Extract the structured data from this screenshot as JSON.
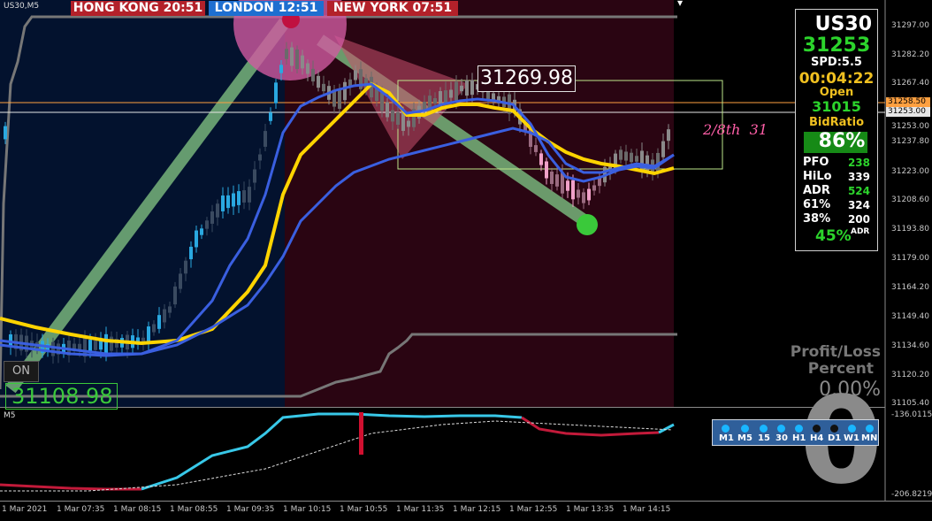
{
  "chart": {
    "symbol_label": "US30,M5",
    "subwindow_label": "M5",
    "on_button": "ON",
    "low_marker": "31108.98",
    "high_marker": "31269.98",
    "fib_text": "2/8th  31",
    "pl_title_1": "Profit/Loss",
    "pl_title_2": "Percent",
    "pl_value": "0.00%",
    "big_counter": "0"
  },
  "sessions": [
    {
      "label": "HONG KONG  20:51",
      "color": "#b3212a"
    },
    {
      "label": "LONDON  12:51",
      "color": "#1e6fd0"
    },
    {
      "label": "NEW YORK  07:51",
      "color": "#b3212a"
    }
  ],
  "panel": {
    "symbol": "US30",
    "price": "31253",
    "spread": "SPD:5.5",
    "countdown": "00:04:22",
    "open_label": "Open",
    "open_value": "31015",
    "bidratio_label": "BidRatio",
    "bidratio_value": "86%",
    "pct_value": "45%",
    "pct_suffix": "ADR",
    "stats": [
      {
        "k": "PFO",
        "v": "238",
        "c": "#2cd42c"
      },
      {
        "k": "HiLo",
        "v": "339",
        "c": "#ffffff"
      },
      {
        "k": "ADR",
        "v": "524",
        "c": "#2cd42c"
      },
      {
        "k": "61%",
        "v": "324",
        "c": "#ffffff"
      },
      {
        "k": "38%",
        "v": "200",
        "c": "#ffffff"
      }
    ]
  },
  "price_axis": [
    "31297.00",
    "31282.20",
    "31267.40",
    "31253.00",
    "31237.80",
    "31223.00",
    "31208.60",
    "31193.80",
    "31179.00",
    "31164.20",
    "31149.40",
    "31134.60",
    "31120.20",
    "31105.40"
  ],
  "price_tags": [
    {
      "label": "31258.50",
      "color": "#ffa040"
    },
    {
      "label": "31253.00",
      "color": "#e6e6e6"
    }
  ],
  "sub_axis": [
    "-136.0115",
    "-206.8219"
  ],
  "time_axis": [
    "1 Mar 2021",
    "1 Mar 07:35",
    "1 Mar 08:15",
    "1 Mar 08:55",
    "1 Mar 09:35",
    "1 Mar 10:15",
    "1 Mar 10:55",
    "1 Mar 11:35",
    "1 Mar 12:15",
    "1 Mar 12:55",
    "1 Mar 13:35",
    "1 Mar 14:15"
  ],
  "timeframes": [
    {
      "label": "M1",
      "color": "#19b6ff"
    },
    {
      "label": "M5",
      "color": "#19b6ff"
    },
    {
      "label": "15",
      "color": "#19b6ff"
    },
    {
      "label": "30",
      "color": "#19b6ff"
    },
    {
      "label": "H1",
      "color": "#19b6ff"
    },
    {
      "label": "H4",
      "color": "#111111"
    },
    {
      "label": "D1",
      "color": "#111111"
    },
    {
      "label": "W1",
      "color": "#19b6ff"
    },
    {
      "label": "MN",
      "color": "#19b6ff"
    }
  ]
}
